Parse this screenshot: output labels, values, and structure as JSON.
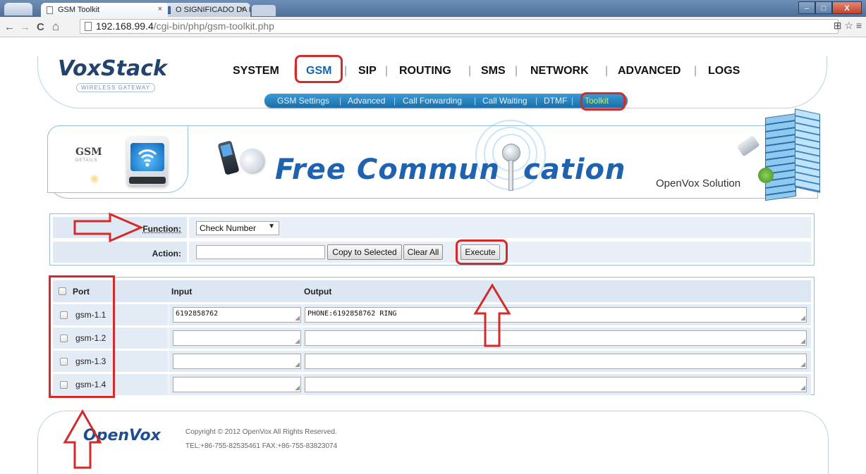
{
  "browser": {
    "tabs": [
      {
        "title": "GSM Toolkit",
        "close": "×"
      },
      {
        "title": "O SIGNIFICADO DA PALA",
        "close": "×"
      }
    ],
    "window_buttons": {
      "minimize": "–",
      "maximize": "□",
      "close": "X"
    },
    "nav": {
      "back": "←",
      "forward": "→",
      "reload": "C",
      "home": "⌂"
    },
    "url": {
      "host": "192.168.99.4",
      "path": "/cgi-bin/php/gsm-toolkit.php"
    },
    "right_icons": "⊞ ☆ ≡"
  },
  "header": {
    "logo": "VoxStack",
    "logo_sub": "WIRELESS GATEWAY",
    "main_nav": [
      "SYSTEM",
      "GSM",
      "SIP",
      "ROUTING",
      "SMS",
      "NETWORK",
      "ADVANCED",
      "LOGS"
    ],
    "main_nav_active": "GSM",
    "sub_nav": [
      "GSM Settings",
      "Advanced",
      "Call Forwarding",
      "Call Waiting",
      "DTMF",
      "Toolkit"
    ],
    "sub_nav_active": "Toolkit"
  },
  "banner": {
    "section_title": "GSM",
    "section_sub": "DETAILS",
    "slogan_part1": "Free Commun",
    "slogan_part2": "cation",
    "company": "OpenVox Solution"
  },
  "form": {
    "function_label": "Function:",
    "function_value": "Check Number",
    "action_label": "Action:",
    "action_value": "",
    "copy_button": "Copy to Selected",
    "clear_button": "Clear All",
    "execute_button": "Execute"
  },
  "table": {
    "headers": {
      "port": "Port",
      "input": "Input",
      "output": "Output"
    },
    "rows": [
      {
        "port": "gsm-1.1",
        "input": "6192858762",
        "output": "PHONE:6192858762 RING"
      },
      {
        "port": "gsm-1.2",
        "input": "",
        "output": ""
      },
      {
        "port": "gsm-1.3",
        "input": "",
        "output": ""
      },
      {
        "port": "gsm-1.4",
        "input": "",
        "output": ""
      }
    ]
  },
  "footer": {
    "logo": "OpenVox",
    "copyright": "Copyright © 2012 OpenVox All Rights Reserved.",
    "contact": "TEL:+86-755-82535461 FAX:+86-755-83823074"
  },
  "colors": {
    "annotation_red": "#d42a2a",
    "accent_blue": "#1565b3",
    "subnav_active": "#bff07a"
  }
}
